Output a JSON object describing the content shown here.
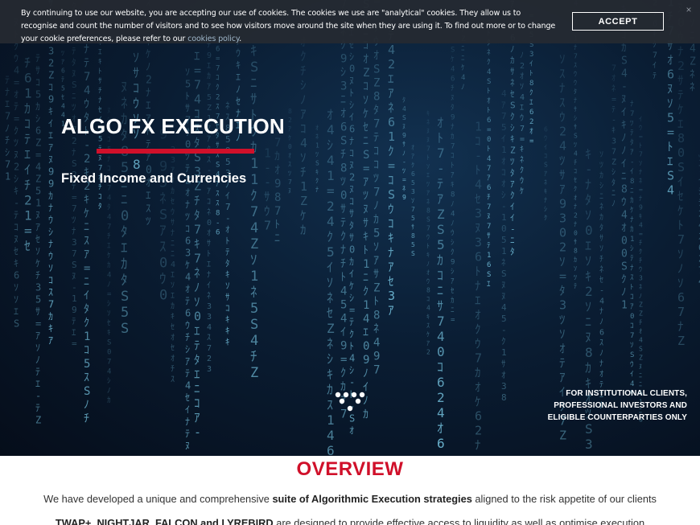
{
  "cookie_banner": {
    "message": "By continuing to use our website, you are accepting our use of cookies. The cookies we use are \"analytical\" cookies. They allow us to recognise and count the number of visitors and to see how visitors move around the site when they are using it. To find out more or to change your cookie preferences, please refer to our",
    "link_text": "cookies policy",
    "link_suffix": ".",
    "accept_label": "ACCEPT",
    "close_glyph": "×"
  },
  "hero": {
    "title": "ALGO FX EXECUTION",
    "subtitle": "Fixed Income and Currencies",
    "disclaimer_lines": [
      "FOR INSTITUTIONAL CLIENTS,",
      "PROFESSIONAL INVESTORS AND",
      "ELIGIBLE COUNTERPARTIES ONLY"
    ],
    "scroll_icon": "chevron-dots-down-icon"
  },
  "overview": {
    "heading": "OVERVIEW",
    "paragraph1": {
      "before": "We have developed a unique and comprehensive ",
      "bold": "suite of Algorithmic Execution strategies",
      "after": " aligned to the risk appetite of our clients"
    },
    "paragraph2": {
      "bold": "TWAP+, NIGHTJAR, FALCON and LYREBIRD",
      "after": " are designed to provide effective access to liquidity as well as optimise execution"
    }
  },
  "colors": {
    "accent_red": "#d0102a",
    "hero_background": "#0a1d33",
    "rain_glyph": "#7fd3f0",
    "cookie_bar": "#262a32"
  }
}
